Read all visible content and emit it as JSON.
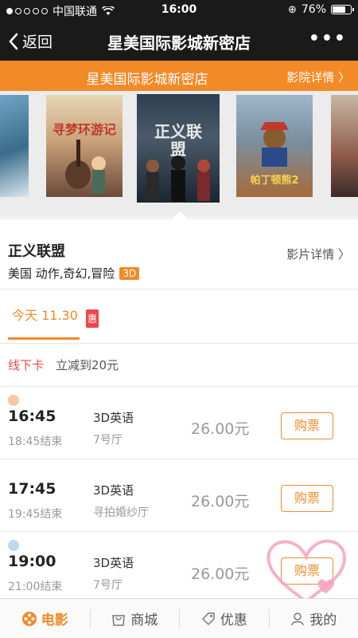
{
  "status_bar": {
    "carrier": "中国联通",
    "time": "16:00",
    "battery": "76%",
    "battery_level": 0.76
  },
  "nav": {
    "back_label": "返回",
    "title": "星美国际影城新密店",
    "more_label": "•••"
  },
  "banner": {
    "cinema_name": "星美国际影城新密店",
    "detail_label": "影院详情"
  },
  "posters": [
    {
      "title": ""
    },
    {
      "title": "寻梦环游记"
    },
    {
      "title": "正义联盟"
    },
    {
      "title": "帕丁顿熊2"
    },
    {
      "title": ""
    }
  ],
  "movie": {
    "title": "正义联盟",
    "detail_label": "影片详情",
    "meta": "美国 动作,奇幻,冒险",
    "format_badge": "3D"
  },
  "date_tab": {
    "label": "今天 11.30",
    "badge": "惠"
  },
  "promo": {
    "card": "线下卡",
    "description": "立减到20元"
  },
  "showtimes": [
    {
      "start": "16:45",
      "end": "18:45结束",
      "lang": "3D英语",
      "hall": "7号厅",
      "price": "26.00元",
      "buy_label": "购票"
    },
    {
      "start": "17:45",
      "end": "19:45结束",
      "lang": "3D英语",
      "hall": "寻拍婚纱厅",
      "price": "26.00元",
      "buy_label": "购票"
    },
    {
      "start": "19:00",
      "end": "21:00结束",
      "lang": "3D英语",
      "hall": "7号厅",
      "price": "26.00元",
      "buy_label": "购票"
    }
  ],
  "tabbar": [
    {
      "label": "电影",
      "icon": "film-icon",
      "active": true
    },
    {
      "label": "商城",
      "icon": "shop-icon",
      "active": false
    },
    {
      "label": "优惠",
      "icon": "tag-icon",
      "active": false
    },
    {
      "label": "我的",
      "icon": "user-icon",
      "active": false
    }
  ],
  "colors": {
    "accent": "#f28a28",
    "nav_bg": "#1a1a1a",
    "promo_red": "#f0464a"
  }
}
